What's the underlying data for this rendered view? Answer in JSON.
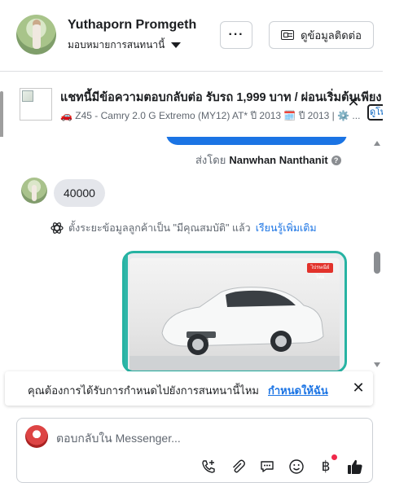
{
  "header": {
    "name": "Yuthaporn Promgeth",
    "assign_label": "มอบหมายการสนทนานี้",
    "more_label": "···",
    "contact_button": "ดูข้อมูลติดต่อ"
  },
  "ad": {
    "title": "แชทนี้มีข้อความตอบกลับต่อ รับรถ 1,999 บาท / ผ่อนเริ่มต้นเพียง",
    "subtitle": "🚗 Z45 - Camry 2.0 G Extremo (MY12) AT* ปี 2013 🗓️ ปี 2013 | ⚙️ ...",
    "more_label": "ดูโพ"
  },
  "chat": {
    "sent_by_prefix": "ส่งโดย",
    "sent_by_agent": "Nanwhan Nanthanit",
    "message": "40000",
    "system_note": "ตั้งระยะข้อมูลลูกค้าเป็น \"มีคุณสมบัติ\" แล้ว",
    "system_link": "เรียนรู้เพิ่มเติม",
    "card_badge": "ไปรษณีย์ไทย"
  },
  "prompt": {
    "text": "คุณต้องการได้รับการกำหนดไปยังการสนทนานี้ไหม",
    "action": "กำหนดให้ฉัน",
    "close": "✕"
  },
  "composer": {
    "placeholder": "ตอบกลับใน Messenger...",
    "tools": [
      "call-add-icon",
      "attach-icon",
      "chat-note-icon",
      "emoji-icon",
      "baht-icon",
      "thumbs-up-icon"
    ]
  },
  "colors": {
    "accent": "#1b74e4",
    "teal": "#26b3a3",
    "badge": "#f0284a"
  }
}
